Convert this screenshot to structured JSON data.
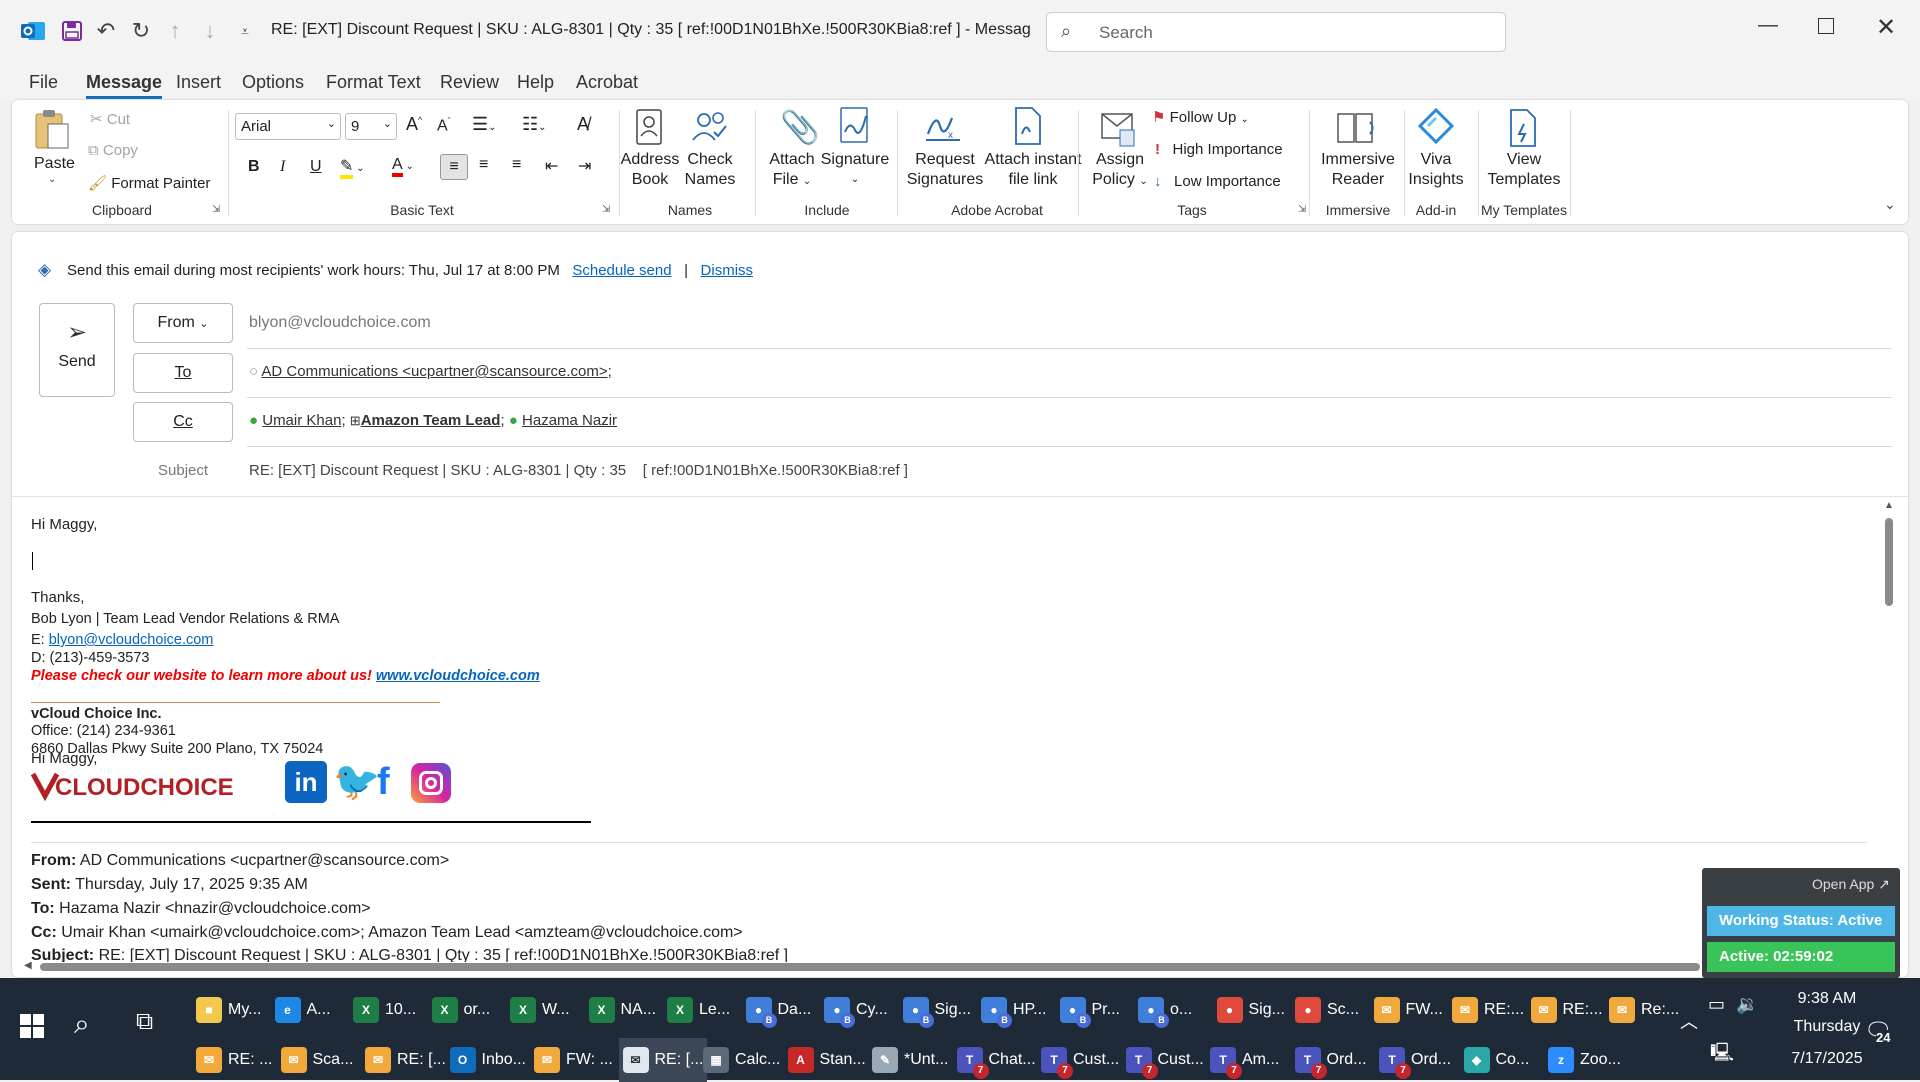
{
  "window": {
    "title": "RE: [EXT] Discount Request | SKU : ALG-8301 | Qty : 35    [ ref:!00D1N01BhXe.!500R30KBia8:ref ]  -  Message (HT...",
    "search_placeholder": "Search"
  },
  "menu": [
    "File",
    "Message",
    "Insert",
    "Options",
    "Format Text",
    "Review",
    "Help",
    "Acrobat"
  ],
  "ribbon": {
    "clipboard": {
      "paste": "Paste",
      "cut": "Cut",
      "copy": "Copy",
      "format_painter": "Format Painter",
      "group": "Clipboard"
    },
    "basic_text": {
      "font": "Arial",
      "size": "9",
      "group": "Basic Text"
    },
    "names": {
      "address_book": [
        "Address",
        "Book"
      ],
      "check_names": [
        "Check",
        "Names"
      ],
      "group": "Names"
    },
    "include": {
      "attach_file": [
        "Attach",
        "File"
      ],
      "signature": "Signature",
      "group": "Include"
    },
    "acrobat": {
      "request_signatures": [
        "Request",
        "Signatures"
      ],
      "attach_instant": [
        "Attach instant",
        "file link"
      ],
      "group": "Adobe Acrobat"
    },
    "tags": {
      "assign_policy": [
        "Assign",
        "Policy"
      ],
      "follow_up": "Follow Up",
      "high_importance": "High Importance",
      "low_importance": "Low Importance",
      "group": "Tags"
    },
    "immersive": {
      "reader": [
        "Immersive",
        "Reader"
      ],
      "group": "Immersive"
    },
    "addin": {
      "viva": [
        "Viva",
        "Insights"
      ],
      "group": "Add-in"
    },
    "templates": {
      "view": [
        "View",
        "Templates"
      ],
      "group": "My Templates"
    }
  },
  "notice": {
    "text": "Send this email during most recipients' work hours: Thu, Jul 17 at 8:00 PM",
    "schedule": "Schedule send",
    "sep": "|",
    "dismiss": "Dismiss"
  },
  "compose": {
    "send": "Send",
    "from_label": "From",
    "from_value": "blyon@vcloudchoice.com",
    "to_label": "To",
    "to_value": "AD Communications <ucpartner@scansource.com>;",
    "cc_label": "Cc",
    "cc1": "Umair Khan",
    "cc_sep1": ";",
    "cc2": "Amazon Team Lead",
    "cc_sep2": ";",
    "cc3": "Hazama Nazir",
    "subject_label": "Subject",
    "subject_value": "RE: [EXT] Discount Request | SKU : ALG-8301 | Qty : 35    [ ref:!00D1N01BhXe.!500R30KBia8:ref ]"
  },
  "body": {
    "greeting": "Hi Maggy,",
    "thanks": "Thanks,",
    "sig_name": "Bob Lyon | Team Lead Vendor Relations & RMA",
    "sig_email_label": "E:",
    "sig_email": "blyon@vcloudchoice.com",
    "sig_phone": "D: (213)-459-3573",
    "sig_promo": "Please check our website to learn more about us!",
    "sig_site": "www.vcloudchoice.com",
    "company": "vCloud Choice Inc.",
    "office": "Office: (214) 234-9361",
    "address": "6860 Dallas Pkwy Suite 200 Plano, TX 75024",
    "logo": "VCLOUDCHOICE",
    "from_label": "From:",
    "from_value": "AD Communications <ucpartner@scansource.com>",
    "sent_label": "Sent:",
    "sent_value": "Thursday, July 17, 2025 9:35 AM",
    "to_label": "To:",
    "to_value": "Hazama Nazir <hnazir@vcloudchoice.com>",
    "cc_label": "Cc:",
    "cc_value": "Umair Khan <umairk@vcloudchoice.com>; Amazon Team Lead <amzteam@vcloudchoice.com>",
    "subject_label": "Subject:",
    "subject_value": "RE: [EXT] Discount Request | SKU : ALG-8301 | Qty : 35 [ ref:!00D1N01BhXe.!500R30KBia8:ref ]"
  },
  "widget": {
    "open_app": "Open App ↗",
    "status": "Working Status: Active",
    "timer": "Active: 02:59:02"
  },
  "taskbar": {
    "row1": [
      {
        "label": "My...",
        "color": "#f2c94c",
        "glyph": "■",
        "badge": ""
      },
      {
        "label": "A...",
        "color": "#1e88e5",
        "glyph": "e",
        "badge": ""
      },
      {
        "label": "10...",
        "color": "#1e7e45",
        "glyph": "X",
        "badge": ""
      },
      {
        "label": "or...",
        "color": "#1e7e45",
        "glyph": "X",
        "badge": ""
      },
      {
        "label": "W...",
        "color": "#1e7e45",
        "glyph": "X",
        "badge": ""
      },
      {
        "label": "NA...",
        "color": "#1e7e45",
        "glyph": "X",
        "badge": ""
      },
      {
        "label": "Le...",
        "color": "#1e7e45",
        "glyph": "X",
        "badge": ""
      },
      {
        "label": "Da...",
        "color": "#3f7fd9",
        "glyph": "●",
        "badge": "B"
      },
      {
        "label": "Cy...",
        "color": "#3f7fd9",
        "glyph": "●",
        "badge": "B"
      },
      {
        "label": "Sig...",
        "color": "#3f7fd9",
        "glyph": "●",
        "badge": "B"
      },
      {
        "label": "HP...",
        "color": "#3f7fd9",
        "glyph": "●",
        "badge": "B"
      },
      {
        "label": "Pr...",
        "color": "#3f7fd9",
        "glyph": "●",
        "badge": "B"
      },
      {
        "label": "o...",
        "color": "#3f7fd9",
        "glyph": "●",
        "badge": "B"
      },
      {
        "label": "Sig...",
        "color": "#e04a3c",
        "glyph": "●",
        "badge": ""
      },
      {
        "label": "Sc...",
        "color": "#e04a3c",
        "glyph": "●",
        "badge": ""
      },
      {
        "label": "FW...",
        "color": "#f2a93b",
        "glyph": "✉",
        "badge": ""
      },
      {
        "label": "RE:...",
        "color": "#f2a93b",
        "glyph": "✉",
        "badge": ""
      },
      {
        "label": "RE:...",
        "color": "#f2a93b",
        "glyph": "✉",
        "badge": ""
      },
      {
        "label": "Re:...",
        "color": "#f2a93b",
        "glyph": "✉",
        "badge": ""
      }
    ],
    "row2": [
      {
        "label": "RE: ...",
        "color": "#f2a93b",
        "glyph": "✉",
        "badge": ""
      },
      {
        "label": "Sca...",
        "color": "#f2a93b",
        "glyph": "✉",
        "badge": ""
      },
      {
        "label": "RE: [...",
        "color": "#f2a93b",
        "glyph": "✉",
        "badge": ""
      },
      {
        "label": "Inbo...",
        "color": "#0f6cbd",
        "glyph": "O",
        "badge": ""
      },
      {
        "label": "FW: ...",
        "color": "#f2a93b",
        "glyph": "✉",
        "badge": ""
      },
      {
        "label": "RE: [...",
        "color": "#dfe6ee",
        "glyph": "✉",
        "badge": ""
      },
      {
        "label": "Calc...",
        "color": "#5a6a7a",
        "glyph": "▦",
        "badge": ""
      },
      {
        "label": "Stan...",
        "color": "#c62828",
        "glyph": "A",
        "badge": ""
      },
      {
        "label": "*Unt...",
        "color": "#9aa7b5",
        "glyph": "✎",
        "badge": ""
      },
      {
        "label": "Chat...",
        "color": "#4b53bc",
        "glyph": "T",
        "badge": "7"
      },
      {
        "label": "Cust...",
        "color": "#4b53bc",
        "glyph": "T",
        "badge": "7"
      },
      {
        "label": "Cust...",
        "color": "#4b53bc",
        "glyph": "T",
        "badge": "7"
      },
      {
        "label": "Am...",
        "color": "#4b53bc",
        "glyph": "T",
        "badge": "7"
      },
      {
        "label": "Ord...",
        "color": "#4b53bc",
        "glyph": "T",
        "badge": "7"
      },
      {
        "label": "Ord...",
        "color": "#4b53bc",
        "glyph": "T",
        "badge": "7"
      },
      {
        "label": "Co...",
        "color": "#2aa7a7",
        "glyph": "◆",
        "badge": ""
      },
      {
        "label": "Zoo...",
        "color": "#2d8cff",
        "glyph": "z",
        "badge": ""
      }
    ],
    "time": "9:38 AM",
    "day": "Thursday",
    "date": "7/17/2025",
    "notifications": "24"
  }
}
